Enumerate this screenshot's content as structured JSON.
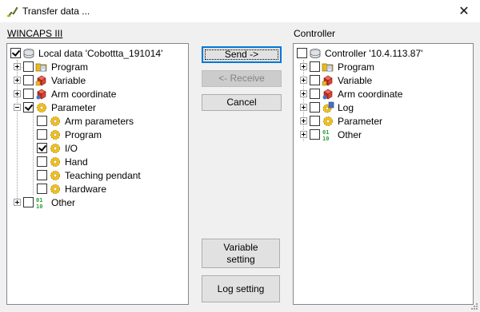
{
  "window": {
    "title": "Transfer data ...",
    "close_glyph": "✕"
  },
  "left_panel": {
    "group_label": "WINCAPS III",
    "root": {
      "label": "Local data 'Cobottta_191014'",
      "checked": true,
      "icon": "database-icon"
    },
    "items": [
      {
        "label": "Program",
        "checked": false,
        "icon": "program-folder-icon",
        "expander": "plus"
      },
      {
        "label": "Variable",
        "checked": false,
        "icon": "variable-cube-icon",
        "expander": "plus"
      },
      {
        "label": "Arm coordinate",
        "checked": false,
        "icon": "arm-coordinate-icon",
        "expander": "plus"
      },
      {
        "label": "Parameter",
        "checked": true,
        "icon": "parameter-gear-icon",
        "expander": "minus",
        "children": [
          {
            "label": "Arm parameters",
            "checked": false,
            "icon": "parameter-gear-icon"
          },
          {
            "label": "Program",
            "checked": false,
            "icon": "parameter-gear-icon"
          },
          {
            "label": "I/O",
            "checked": true,
            "icon": "parameter-gear-icon"
          },
          {
            "label": "Hand",
            "checked": false,
            "icon": "parameter-gear-icon"
          },
          {
            "label": "Teaching pendant",
            "checked": false,
            "icon": "parameter-gear-icon"
          },
          {
            "label": "Hardware",
            "checked": false,
            "icon": "parameter-gear-icon"
          }
        ]
      },
      {
        "label": "Other",
        "checked": false,
        "icon": "binary-icon",
        "expander": "plus"
      }
    ]
  },
  "right_panel": {
    "group_label": "Controller",
    "root": {
      "label": "Controller '10.4.113.87'",
      "checked": false,
      "icon": "database-icon"
    },
    "items": [
      {
        "label": "Program",
        "checked": false,
        "icon": "program-folder-icon"
      },
      {
        "label": "Variable",
        "checked": false,
        "icon": "variable-cube-icon"
      },
      {
        "label": "Arm coordinate",
        "checked": false,
        "icon": "arm-coordinate-icon"
      },
      {
        "label": "Log",
        "checked": false,
        "icon": "log-gear-icon"
      },
      {
        "label": "Parameter",
        "checked": false,
        "icon": "parameter-gear-icon"
      },
      {
        "label": "Other",
        "checked": false,
        "icon": "binary-icon"
      }
    ]
  },
  "buttons": {
    "send": "Send ->",
    "receive": "<- Receive",
    "cancel": "Cancel",
    "variable_setting": "Variable setting",
    "log_setting": "Log setting"
  },
  "colors": {
    "accent": "#0078d7",
    "folder": "#e8b923",
    "cube_red": "#d83b2b",
    "gear": "#f2c21b",
    "binary_green": "#2e9e3a"
  }
}
